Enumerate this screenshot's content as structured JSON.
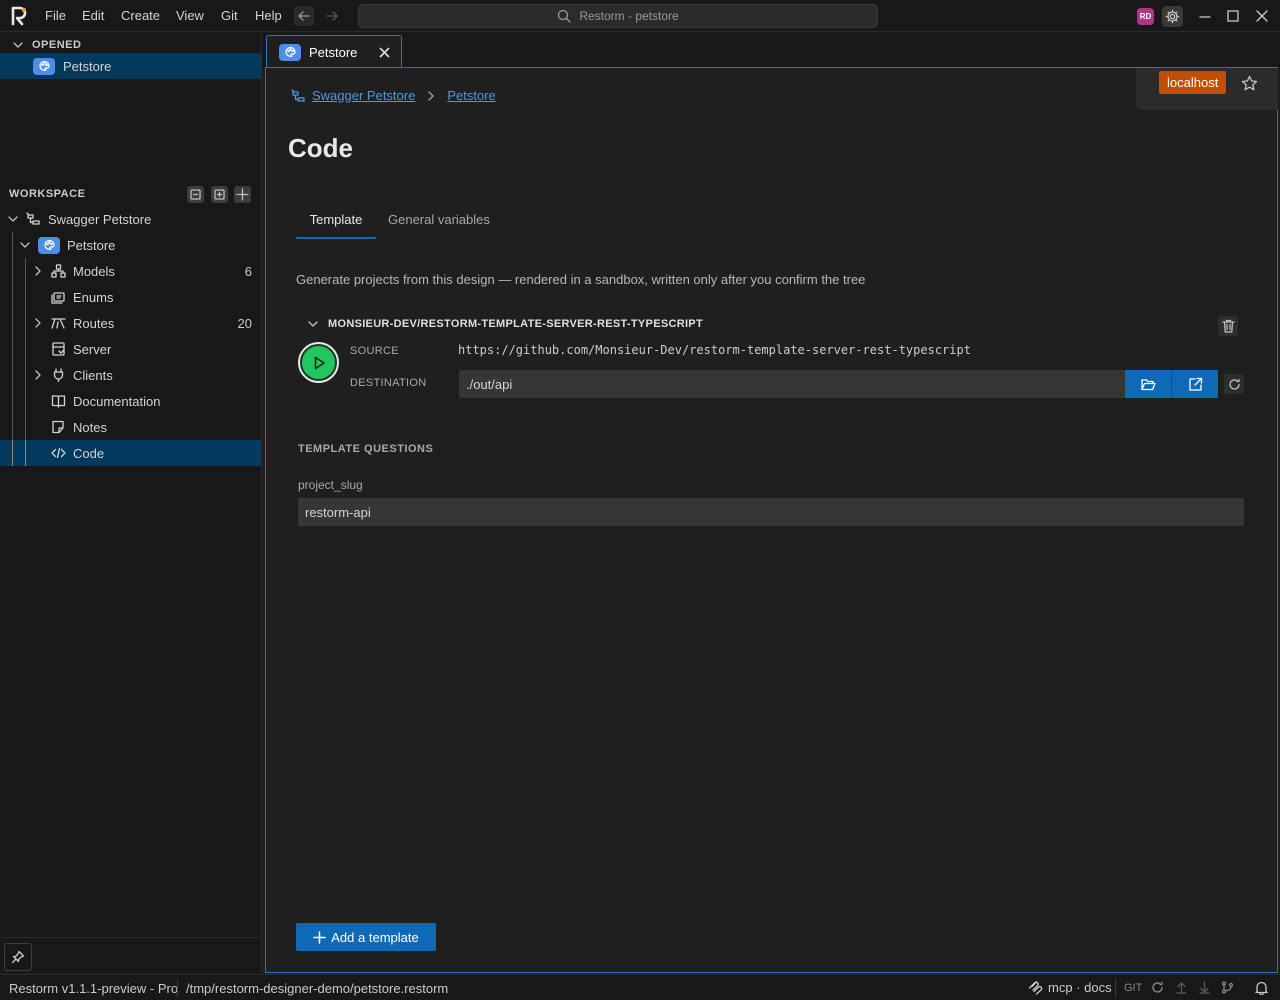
{
  "titlebar": {
    "menus": [
      "File",
      "Edit",
      "Create",
      "View",
      "Git",
      "Help"
    ],
    "search_text": "Restorm - petstore",
    "avatar_initials": "RD"
  },
  "sidebar": {
    "opened_header": "OPENED",
    "opened_item": "Petstore",
    "workspace_header": "WORKSPACE",
    "project": "Swagger Petstore",
    "design": "Petstore",
    "items": [
      {
        "label": "Models",
        "count": "6"
      },
      {
        "label": "Enums",
        "count": ""
      },
      {
        "label": "Routes",
        "count": "20"
      },
      {
        "label": "Server",
        "count": ""
      },
      {
        "label": "Clients",
        "count": ""
      },
      {
        "label": "Documentation",
        "count": ""
      },
      {
        "label": "Notes",
        "count": ""
      },
      {
        "label": "Code",
        "count": ""
      }
    ]
  },
  "tab": {
    "label": "Petstore"
  },
  "breadcrumb": {
    "project": "Swagger Petstore",
    "design": "Petstore"
  },
  "env": {
    "label": "localhost"
  },
  "page": {
    "title": "Code",
    "tabs": [
      "Template",
      "General variables"
    ],
    "active_tab": "Template",
    "description": "Generate projects from this design — rendered in a sandbox, written only after you confirm the tree"
  },
  "template": {
    "name": "MONSIEUR-DEV/RESTORM-TEMPLATE-SERVER-REST-TYPESCRIPT",
    "source_label": "SOURCE",
    "source_value": "https://github.com/Monsieur-Dev/restorm-template-server-rest-typescript",
    "destination_label": "DESTINATION",
    "destination_value": "./out/api"
  },
  "questions": {
    "header": "TEMPLATE QUESTIONS",
    "field_label": "project_slug",
    "field_value": "restorm-api"
  },
  "add_template_label": "Add a template",
  "statusbar": {
    "version": "Restorm v1.1.1-preview - Pro",
    "path": "/tmp/restorm-designer-demo/petstore.restorm",
    "mcp": "mcp · docs",
    "git": "GIT"
  },
  "colors": {
    "accent": "#0e6ab7",
    "selection": "#04395e",
    "env_badge": "#c44e00",
    "run_button": "#22c55e",
    "link": "#4a9ae6"
  }
}
